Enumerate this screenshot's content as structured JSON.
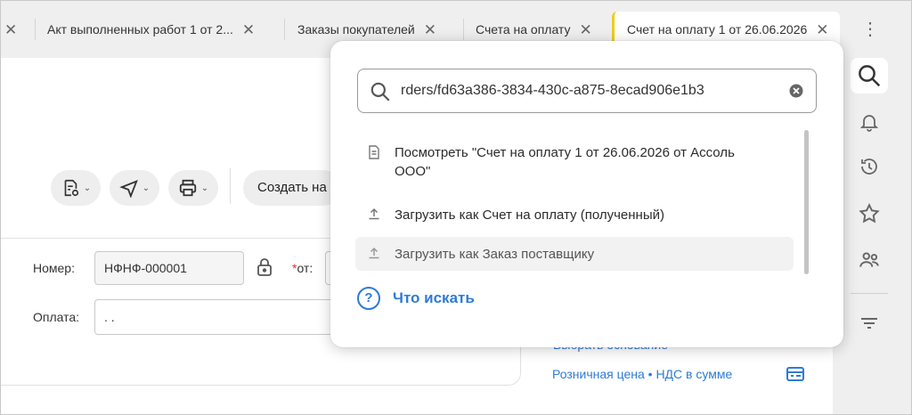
{
  "tabs": [
    {
      "label": "Акт выполненных работ 1 от 2..."
    },
    {
      "label": "Заказы покупателей"
    },
    {
      "label": "Счета на оплату"
    },
    {
      "label": "Счет на оплату 1 от 26.06.2026"
    }
  ],
  "toolbar": {
    "create_label": "Создать на основании"
  },
  "form": {
    "number_label": "Номер:",
    "number_value": "НФНФ-000001",
    "from_required_mark": "*",
    "from_label": "от:",
    "payment_label": "Оплата:",
    "payment_value": " .  ."
  },
  "links": {
    "choose_basis": "Выбрать основание",
    "price_type": "Розничная цена • НДС в сумме"
  },
  "search": {
    "value": "rders/fd63a386-3834-430c-a875-8ecad906e1b3",
    "suggestions": [
      {
        "icon": "document-icon",
        "label": "Посмотреть \"Счет на оплату 1 от 26.06.2026 от Ассоль ООО\""
      },
      {
        "icon": "upload-icon",
        "label": "Загрузить как Счет на оплату (полученный)"
      },
      {
        "icon": "upload-icon",
        "label": "Загрузить как Заказ поставщику"
      }
    ],
    "help_label": "Что искать"
  },
  "sidebar_icons": [
    "search-icon",
    "bell-icon",
    "history-icon",
    "star-icon",
    "users-icon",
    "filter-lines-icon"
  ],
  "colors": {
    "accent": "#2e7bd6",
    "active_tab_marker": "#f2cd19",
    "required": "#e0312d"
  }
}
